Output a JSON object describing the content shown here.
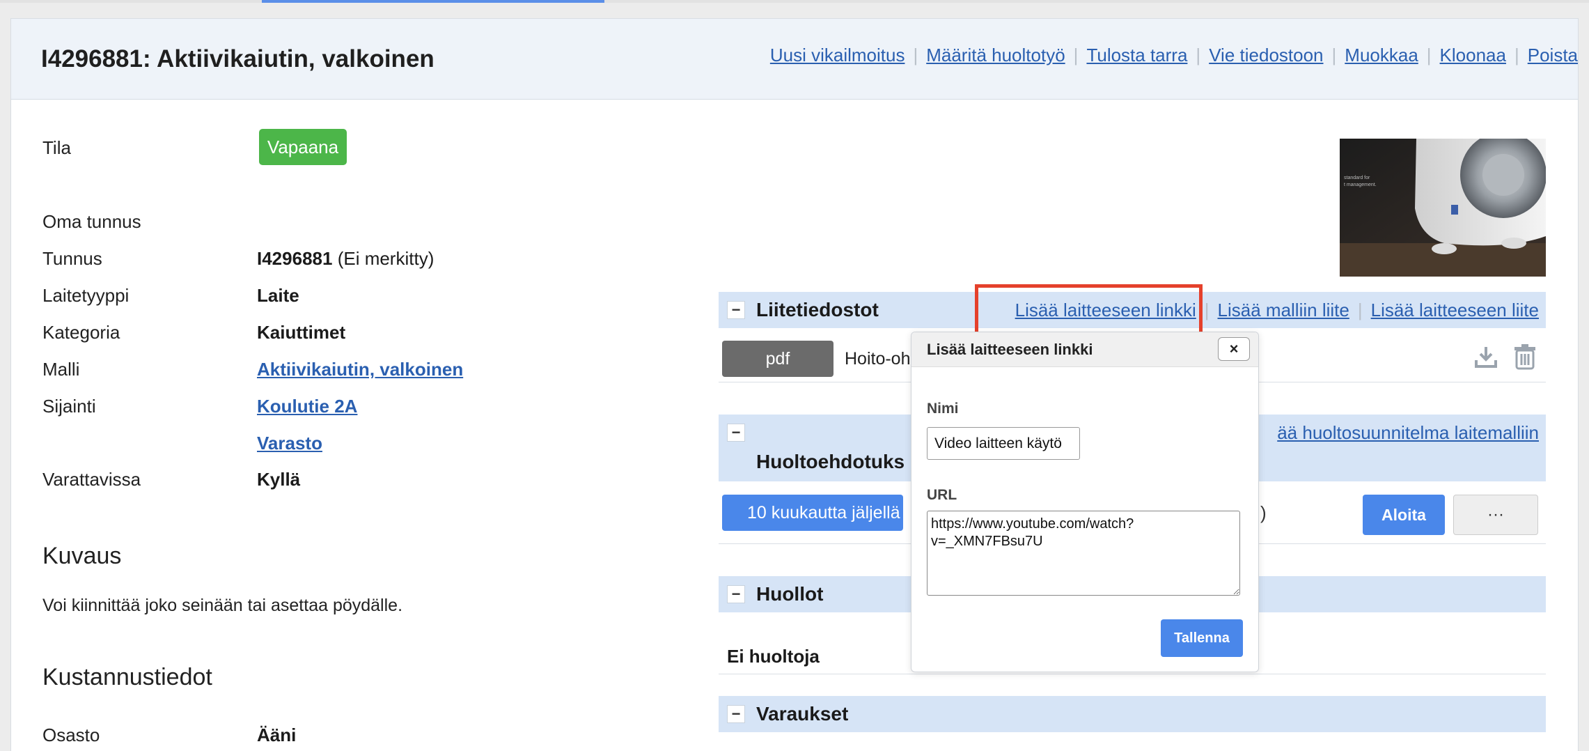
{
  "page": {
    "title": "I4296881: Aktiivikaiutin, valkoinen",
    "actions": [
      "Uusi vikailmoitus",
      "Määritä huoltotyö",
      "Tulosta tarra",
      "Vie tiedostoon",
      "Muokkaa",
      "Kloonaa",
      "Poista"
    ]
  },
  "info": {
    "tila_label": "Tila",
    "tila_value": "Vapaana",
    "oma_tunnus_label": "Oma tunnus",
    "tunnus_label": "Tunnus",
    "tunnus_value": "I4296881",
    "tunnus_note": "(Ei merkitty)",
    "laitetyyppi_label": "Laitetyyppi",
    "laitetyyppi_value": "Laite",
    "kategoria_label": "Kategoria",
    "kategoria_value": "Kaiuttimet",
    "malli_label": "Malli",
    "malli_value": "Aktiivikaiutin, valkoinen",
    "sijainti_label": "Sijainti",
    "sijainti_value_1": "Koulutie 2A",
    "sijainti_value_2": "Varasto",
    "varattavissa_label": "Varattavissa",
    "varattavissa_value": "Kyllä"
  },
  "kuvaus": {
    "heading": "Kuvaus",
    "text": "Voi kiinnittää joko seinään tai asettaa pöydälle."
  },
  "kustannus": {
    "heading": "Kustannustiedot",
    "osasto_label": "Osasto",
    "osasto_value": "Ääni"
  },
  "photo_text": "standard for\nt management.",
  "attachments": {
    "title": "Liitetiedostot",
    "links": [
      "Lisää laitteeseen linkki",
      "Lisää malliin liite",
      "Lisää laitteeseen liite"
    ],
    "file_type": "pdf",
    "file_name": "Hoito-oh"
  },
  "maintenance_suggestions": {
    "title": "Huoltoehdotuks",
    "link": "ää huoltosuunnitelma laitemalliin",
    "months_left": "10 kuukautta jäljellä",
    "paren": ")",
    "start_button": "Aloita",
    "more_button": "···"
  },
  "services": {
    "title": "Huollot",
    "empty": "Ei huoltoja"
  },
  "reservations": {
    "title": "Varaukset"
  },
  "popup": {
    "title": "Lisää laitteeseen linkki",
    "close": "×",
    "name_label": "Nimi",
    "name_value": "Video laitteen käytö",
    "url_label": "URL",
    "url_value": "https://www.youtube.com/watch?v=_XMN7FBsu7U",
    "save_button": "Tallenna"
  },
  "colors": {
    "accent": "#4a87ea",
    "link": "#2a5fb0",
    "status_green": "#4cb649",
    "highlight": "#e5412c",
    "section_bar": "#d6e4f6"
  },
  "icons": {
    "collapse": "minus-icon",
    "download": "download-icon",
    "delete": "trash-icon",
    "close": "close-icon"
  }
}
